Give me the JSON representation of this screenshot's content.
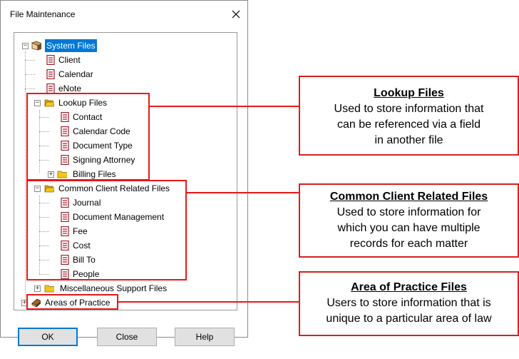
{
  "dialog": {
    "title": "File Maintenance",
    "close_icon": "close-icon"
  },
  "tree": {
    "root": {
      "label": "System Files",
      "icon": "book-open-icon",
      "selected": true
    },
    "system_children": [
      "Client",
      "Calendar",
      "eNote"
    ],
    "lookup": {
      "label": "Lookup Files",
      "icon": "folder-open-icon",
      "children": [
        "Contact",
        "Calendar Code",
        "Document Type",
        "Signing Attorney"
      ],
      "billing": "Billing Files"
    },
    "common": {
      "label": "Common Client Related Files",
      "icon": "folder-open-icon",
      "children": [
        "Journal",
        "Document Management",
        "Fee",
        "Cost",
        "Bill To",
        "People"
      ]
    },
    "misc": "Miscellaneous Support Files",
    "areas": "Areas of Practice",
    "expand_symbol": "+",
    "collapse_symbol": "−"
  },
  "buttons": {
    "ok": "OK",
    "close": "Close",
    "help": "Help"
  },
  "callouts": {
    "lookup": {
      "heading": "Lookup Files",
      "lines": [
        "Used to store information that",
        "can be referenced via a field",
        "in another file"
      ]
    },
    "common": {
      "heading": "Common Client Related Files",
      "lines": [
        "Used to store information for",
        "which you can have multiple",
        "records for each matter"
      ]
    },
    "areas": {
      "heading": "Area of Practice Files",
      "lines": [
        "Users to store information that is",
        "unique to a particular area of law"
      ]
    }
  },
  "colors": {
    "selection": "#0078d7",
    "highlight_red": "#e81818",
    "doc_icon": "#9b1a2a",
    "folder": "#f5c518"
  }
}
